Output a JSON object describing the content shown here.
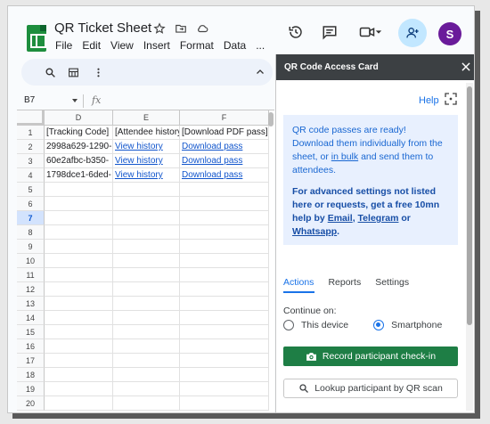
{
  "app": {
    "title": "QR Ticket Sheet",
    "menu": [
      "File",
      "Edit",
      "View",
      "Insert",
      "Format",
      "Data",
      "..."
    ],
    "avatar_letter": "S",
    "accent": "#1e8e3e"
  },
  "formula_bar": {
    "cell_ref": "B7",
    "fx": "fx"
  },
  "sheet": {
    "columns": [
      "D",
      "E",
      "F"
    ],
    "rows": [
      "1",
      "2",
      "3",
      "4",
      "5",
      "6",
      "7",
      "8",
      "9",
      "10",
      "11",
      "12",
      "13",
      "14",
      "15",
      "16",
      "17",
      "18",
      "19",
      "20"
    ],
    "selected_row": "7",
    "cells": {
      "r1": [
        "[Tracking Code]",
        "[Attendee history",
        "[Download PDF pass]"
      ],
      "r2": [
        "2998a629-1290-",
        "View history",
        "Download pass"
      ],
      "r3": [
        "60e2afbc-b350-",
        "View history",
        "Download pass"
      ],
      "r4": [
        "1798dce1-6ded-",
        "View history",
        "Download pass"
      ]
    }
  },
  "panel": {
    "title": "QR Code Access Card",
    "help": "Help",
    "info_text_1": "QR code passes are ready! Download them individually from the sheet, or",
    "info_link_bulk": "in bulk",
    "info_text_1b": "and send them to attendees.",
    "info_text_2": "For advanced settings not listed here or requests, get a free 10mn help by",
    "info_link_email": "Email",
    "info_comma": ",",
    "info_link_telegram": "Telegram",
    "info_or": "or",
    "info_link_whatsapp": "Whatsapp",
    "info_period": ".",
    "tabs": [
      "Actions",
      "Reports",
      "Settings"
    ],
    "continue_label": "Continue on:",
    "option_device": "This device",
    "option_phone": "Smartphone",
    "btn_checkin": "Record participant check-in",
    "btn_lookup": "Lookup participant by QR scan",
    "checkin_color": "#1e7e45"
  }
}
